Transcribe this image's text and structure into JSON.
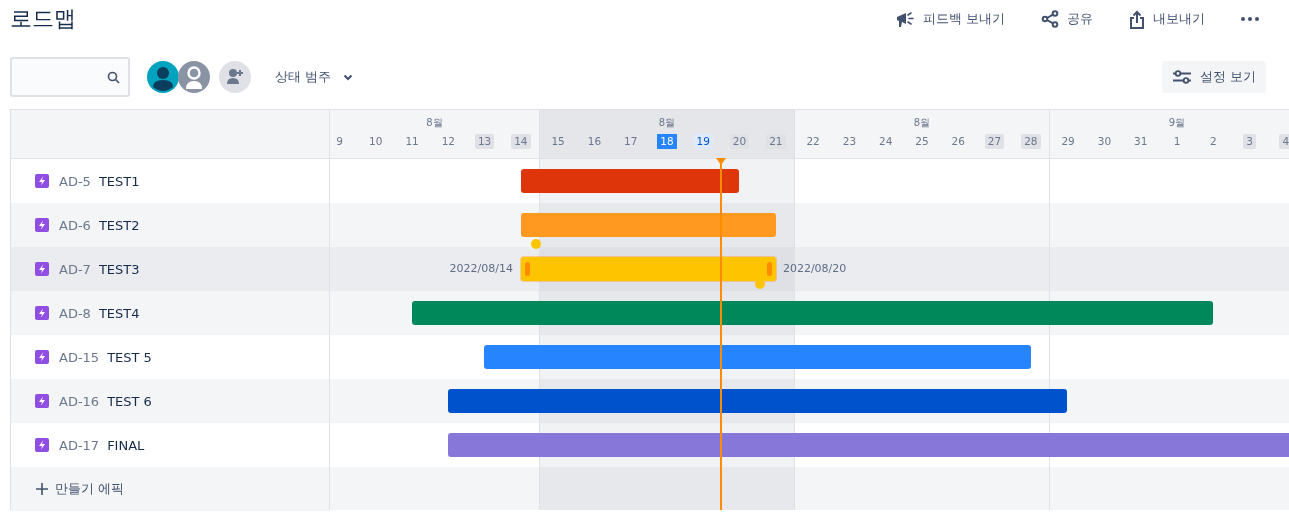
{
  "page": {
    "title": "로드맵"
  },
  "actions": [
    {
      "kind": "feedback",
      "label": "피드백 보내기"
    },
    {
      "kind": "share",
      "label": "공유"
    },
    {
      "kind": "export",
      "label": "내보내기"
    },
    {
      "kind": "more"
    }
  ],
  "toolbar": {
    "avatars": [
      {
        "kind": "teal"
      },
      {
        "kind": "gray"
      },
      {
        "kind": "add"
      }
    ],
    "filter": {
      "label": "상태 범주"
    },
    "settings": {
      "label": "설정 보기"
    }
  },
  "timeline": {
    "weeks": [
      {
        "label": "8월",
        "shaded": false,
        "days": [
          {
            "label": "9",
            "kind": "plain"
          },
          {
            "label": "10",
            "kind": "plain"
          },
          {
            "label": "11",
            "kind": "plain"
          },
          {
            "label": "12",
            "kind": "plain"
          },
          {
            "label": "13",
            "kind": "weekend"
          },
          {
            "label": "14",
            "kind": "weekend"
          }
        ]
      },
      {
        "label": "8월",
        "shaded": true,
        "days": [
          {
            "label": "15",
            "kind": "plain"
          },
          {
            "label": "16",
            "kind": "plain"
          },
          {
            "label": "17",
            "kind": "plain"
          },
          {
            "label": "18",
            "kind": "selected"
          },
          {
            "label": "19",
            "kind": "today"
          },
          {
            "label": "20",
            "kind": "weekend"
          },
          {
            "label": "21",
            "kind": "weekend"
          }
        ]
      },
      {
        "label": "8월",
        "shaded": false,
        "days": [
          {
            "label": "22",
            "kind": "plain"
          },
          {
            "label": "23",
            "kind": "plain"
          },
          {
            "label": "24",
            "kind": "plain"
          },
          {
            "label": "25",
            "kind": "plain"
          },
          {
            "label": "26",
            "kind": "plain"
          },
          {
            "label": "27",
            "kind": "weekend"
          },
          {
            "label": "28",
            "kind": "weekend"
          }
        ]
      },
      {
        "label": "9월",
        "shaded": false,
        "days": [
          {
            "label": "29",
            "kind": "plain"
          },
          {
            "label": "30",
            "kind": "plain"
          },
          {
            "label": "31",
            "kind": "plain"
          },
          {
            "label": "1",
            "kind": "plain"
          },
          {
            "label": "2",
            "kind": "plain"
          },
          {
            "label": "3",
            "kind": "weekend"
          },
          {
            "label": "4",
            "kind": "weekend"
          }
        ]
      }
    ]
  },
  "epics": [
    {
      "key": "AD-5",
      "title": "TEST1",
      "hovered": false,
      "color": "#de350b"
    },
    {
      "key": "AD-6",
      "title": "TEST2",
      "hovered": false,
      "color": "#ff991f"
    },
    {
      "key": "AD-7",
      "title": "TEST3",
      "hovered": true,
      "color": "#ffc400",
      "start_label": "2022/08/14",
      "end_label": "2022/08/20"
    },
    {
      "key": "AD-8",
      "title": "TEST4",
      "hovered": false,
      "color": "#00875a"
    },
    {
      "key": "AD-15",
      "title": "TEST 5",
      "hovered": false,
      "color": "#2684ff"
    },
    {
      "key": "AD-16",
      "title": "TEST 6",
      "hovered": false,
      "color": "#0052cc"
    },
    {
      "key": "AD-17",
      "title": "FINAL",
      "hovered": false,
      "color": "#8777d9"
    }
  ],
  "create": {
    "label": "만들기 에픽"
  }
}
